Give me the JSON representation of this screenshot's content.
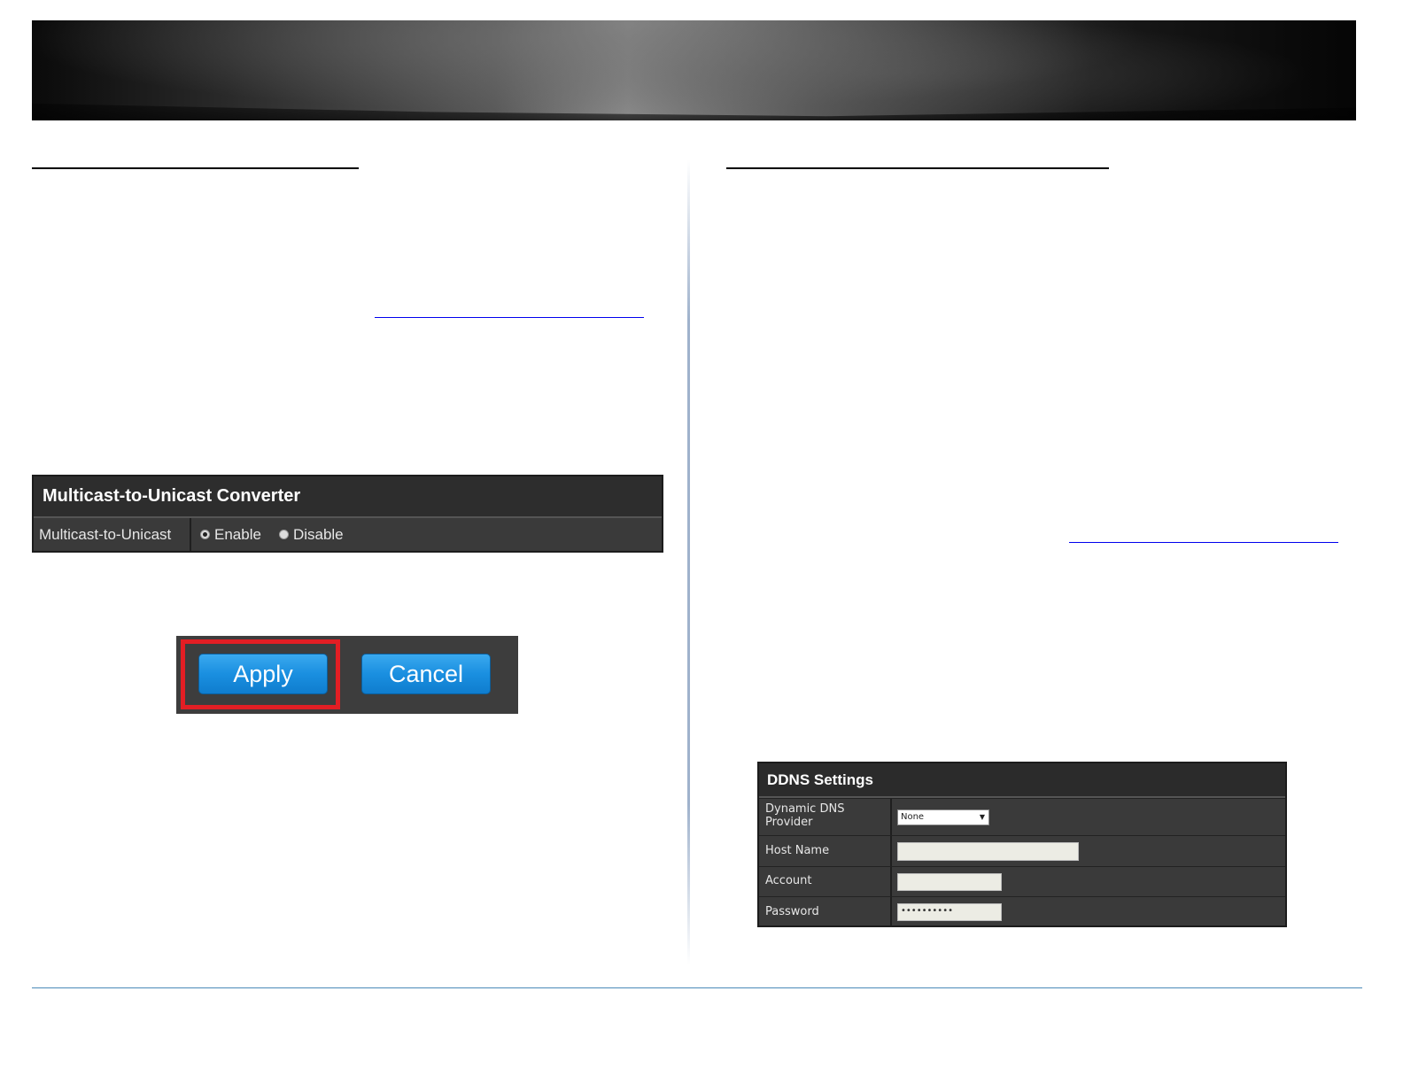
{
  "multicast_panel": {
    "title": "Multicast-to-Unicast Converter",
    "row_label": "Multicast-to-Unicast",
    "options": [
      "Enable",
      "Disable"
    ],
    "selected": "Enable"
  },
  "buttons": {
    "apply": "Apply",
    "cancel": "Cancel"
  },
  "ddns_panel": {
    "title": "DDNS Settings",
    "provider_label": "Dynamic DNS Provider",
    "provider_value": "None",
    "host_label": "Host Name",
    "host_value": "",
    "account_label": "Account",
    "account_value": "",
    "password_label": "Password",
    "password_value": "••••••••••"
  },
  "colors": {
    "highlight": "#e31e24",
    "button_blue": "#1a8fe0",
    "panel_dark": "#3a3a3a",
    "footer_rule": "#4a8ab8"
  }
}
